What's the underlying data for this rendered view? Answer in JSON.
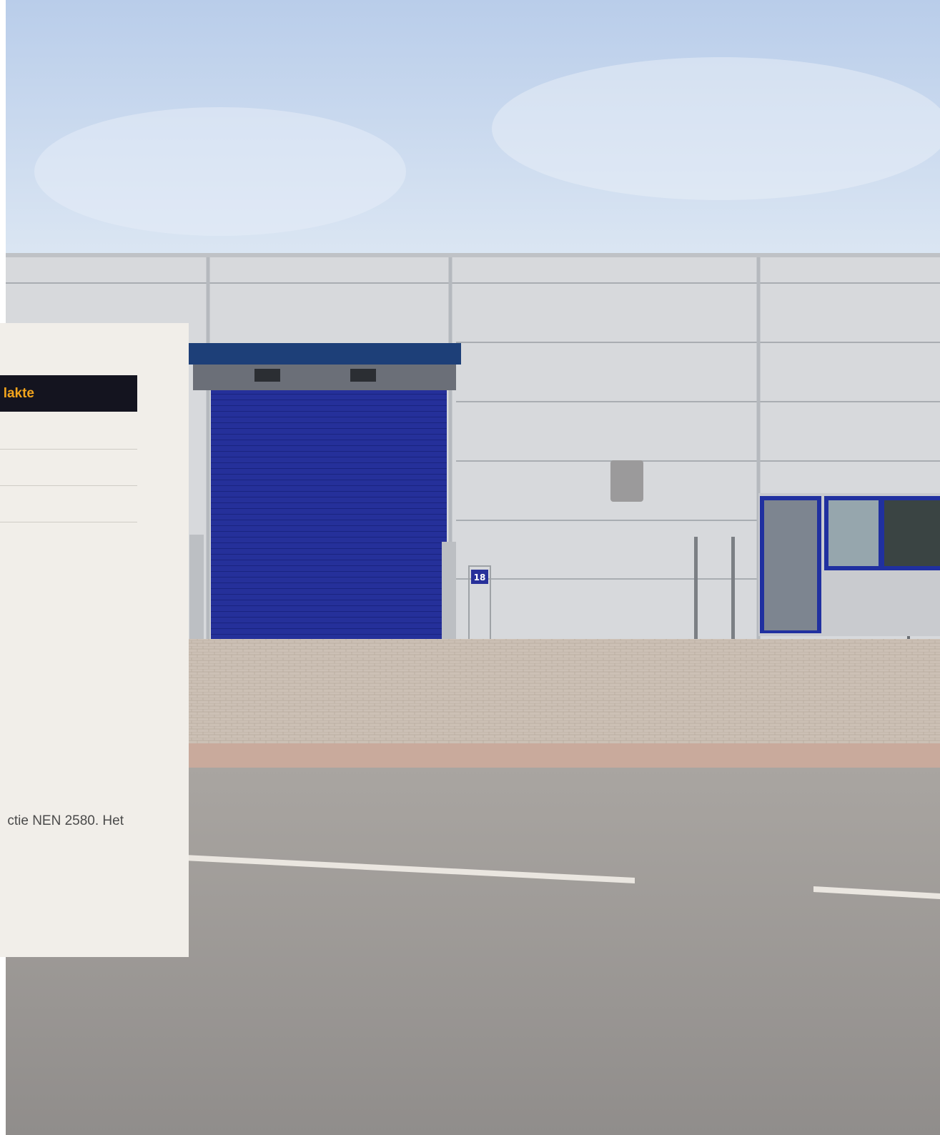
{
  "panel": {
    "cta_label": "lakte",
    "body_text": "ctie NEN 2580. Het"
  },
  "photo": {
    "door_number": "18"
  },
  "colors": {
    "panel_bg": "#f1eee9",
    "button_bg": "#14141f",
    "button_text": "#f3a51c",
    "door_blue": "#1f2f8f"
  }
}
